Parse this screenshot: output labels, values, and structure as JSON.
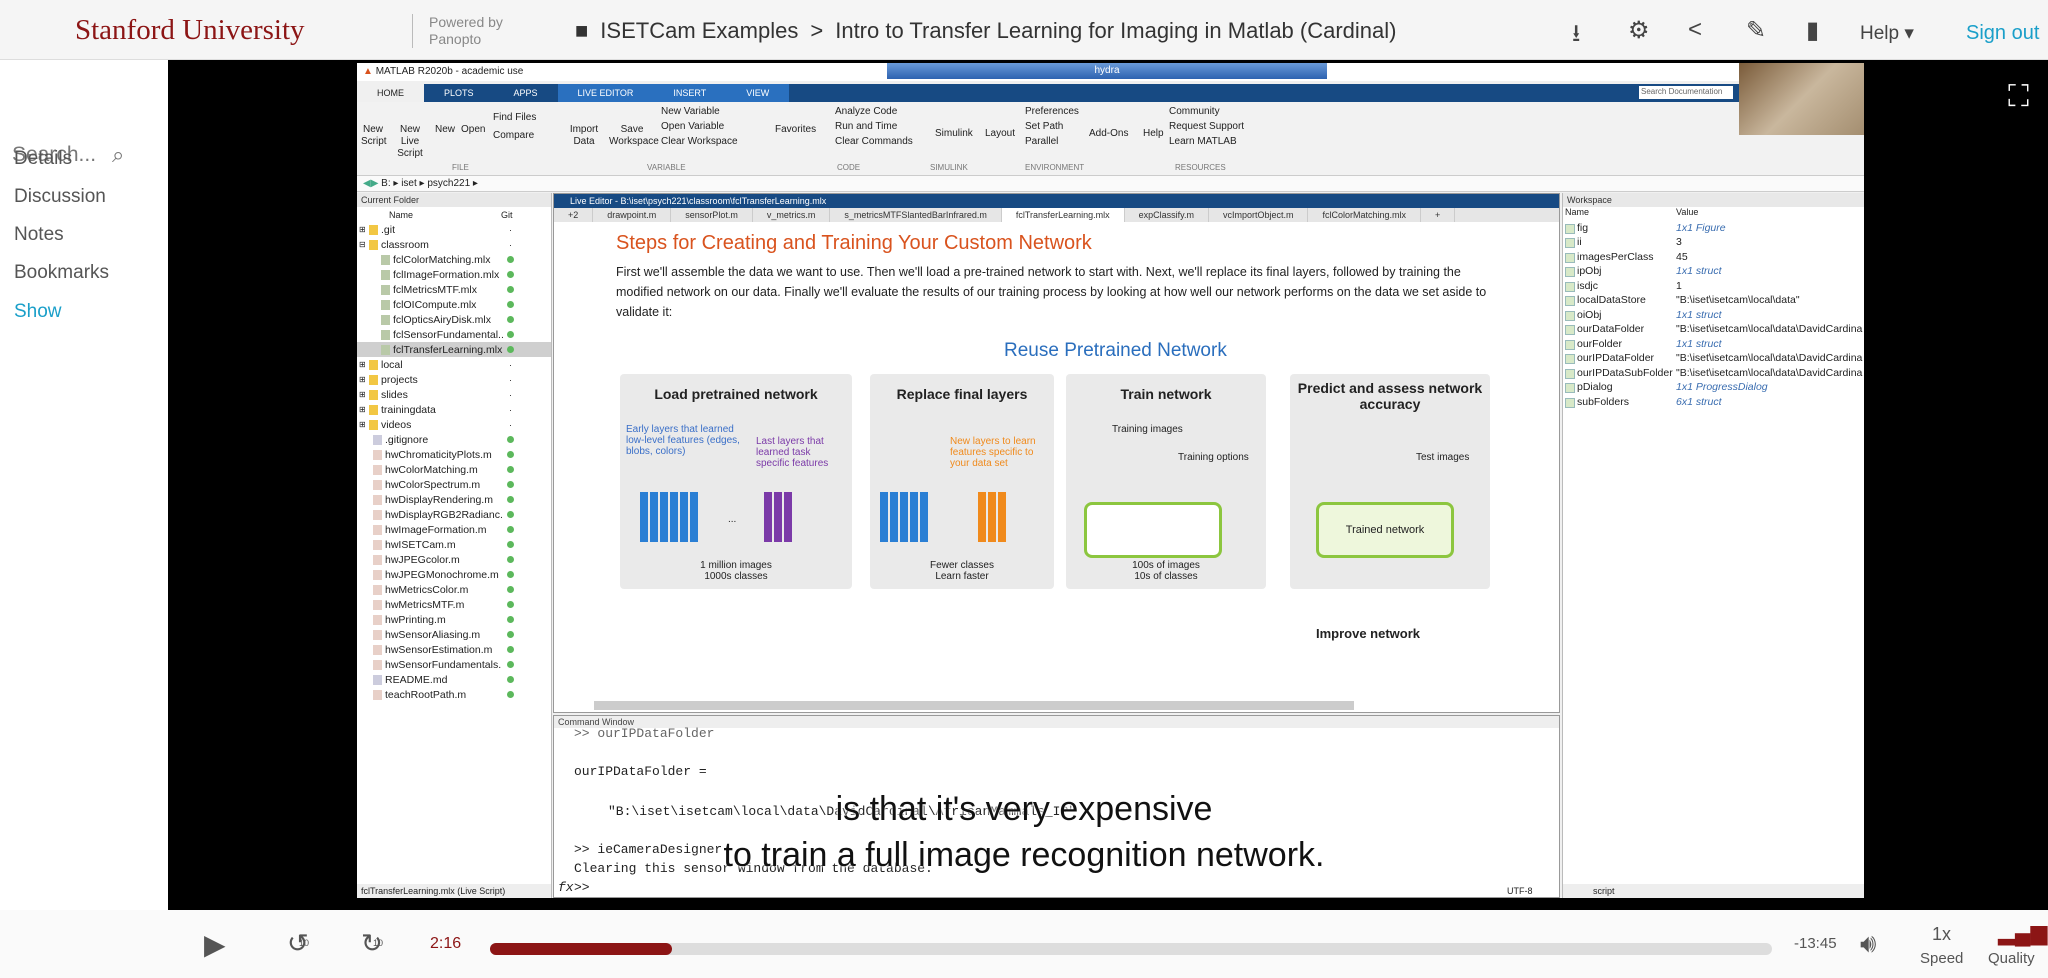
{
  "header": {
    "logo": "Stanford University",
    "powered_by": "Powered by Panopto",
    "folder": "ISETCam Examples",
    "separator": ">",
    "title": "Intro to Transfer Learning for Imaging in Matlab (Cardinal)",
    "help": "Help",
    "sign_out": "Sign out",
    "icons": [
      "download-icon",
      "gear-icon",
      "share-icon",
      "pencil-icon",
      "stats-icon"
    ]
  },
  "sidebar": {
    "search_placeholder": "Search...",
    "items": [
      "Details",
      "Discussion",
      "Notes",
      "Bookmarks",
      "Show"
    ]
  },
  "matlab": {
    "title": "MATLAB R2020b - academic use",
    "remote_title": "hydra",
    "search_doc": "Search Documentation",
    "tabs": [
      "HOME",
      "PLOTS",
      "APPS",
      "LIVE EDITOR",
      "INSERT",
      "VIEW"
    ],
    "ribbon": {
      "new_script": "New Script",
      "new_live_script": "New Live Script",
      "new": "New",
      "open": "Open",
      "find_files": "Find Files",
      "compare": "Compare",
      "import_data": "Import Data",
      "save_workspace": "Save Workspace",
      "new_variable": "New Variable",
      "open_variable": "Open Variable",
      "clear_workspace": "Clear Workspace",
      "favorites": "Favorites",
      "analyze_code": "Analyze Code",
      "run_and_time": "Run and Time",
      "clear_commands": "Clear Commands",
      "simulink": "Simulink",
      "layout": "Layout",
      "preferences": "Preferences",
      "set_path": "Set Path",
      "parallel": "Parallel",
      "add_ons": "Add-Ons",
      "help": "Help",
      "community": "Community",
      "request_support": "Request Support",
      "learn_matlab": "Learn MATLAB",
      "groups": [
        "FILE",
        "VARIABLE",
        "CODE",
        "SIMULINK",
        "ENVIRONMENT",
        "RESOURCES"
      ]
    },
    "address": "B: ▸ iset ▸ psych221 ▸",
    "current_folder": {
      "title": "Current Folder",
      "col_name": "Name",
      "col_git": "Git",
      "items": [
        {
          "name": ".git",
          "type": "folder",
          "git": "dot",
          "indent": 0
        },
        {
          "name": "classroom",
          "type": "folder",
          "git": "dot",
          "indent": 0
        },
        {
          "name": "fclColorMatching.mlx",
          "type": "mlx",
          "git": "ok",
          "indent": 1
        },
        {
          "name": "fclImageFormation.mlx",
          "type": "mlx",
          "git": "ok",
          "indent": 1
        },
        {
          "name": "fclMetricsMTF.mlx",
          "type": "mlx",
          "git": "ok",
          "indent": 1
        },
        {
          "name": "fclOICompute.mlx",
          "type": "mlx",
          "git": "ok",
          "indent": 1
        },
        {
          "name": "fclOpticsAiryDisk.mlx",
          "type": "mlx",
          "git": "ok",
          "indent": 1
        },
        {
          "name": "fclSensorFundamental..",
          "type": "mlx",
          "git": "ok",
          "indent": 1
        },
        {
          "name": "fclTransferLearning.mlx",
          "type": "mlx",
          "git": "ok",
          "indent": 1,
          "selected": true
        },
        {
          "name": "local",
          "type": "folder",
          "git": "dot",
          "indent": 0
        },
        {
          "name": "projects",
          "type": "folder",
          "git": "dot",
          "indent": 0
        },
        {
          "name": "slides",
          "type": "folder",
          "git": "dot",
          "indent": 0
        },
        {
          "name": "trainingdata",
          "type": "folder",
          "git": "dot",
          "indent": 0
        },
        {
          "name": "videos",
          "type": "folder",
          "git": "dot",
          "indent": 0
        },
        {
          "name": ".gitignore",
          "type": "file",
          "git": "ok",
          "indent": 0
        },
        {
          "name": "hwChromaticityPlots.m",
          "type": "m",
          "git": "ok",
          "indent": 0
        },
        {
          "name": "hwColorMatching.m",
          "type": "m",
          "git": "ok",
          "indent": 0
        },
        {
          "name": "hwColorSpectrum.m",
          "type": "m",
          "git": "ok",
          "indent": 0
        },
        {
          "name": "hwDisplayRendering.m",
          "type": "m",
          "git": "ok",
          "indent": 0
        },
        {
          "name": "hwDisplayRGB2Radianc.",
          "type": "m",
          "git": "ok",
          "indent": 0
        },
        {
          "name": "hwImageFormation.m",
          "type": "m",
          "git": "ok",
          "indent": 0
        },
        {
          "name": "hwISETCam.m",
          "type": "m",
          "git": "ok",
          "indent": 0
        },
        {
          "name": "hwJPEGcolor.m",
          "type": "m",
          "git": "ok",
          "indent": 0
        },
        {
          "name": "hwJPEGMonochrome.m",
          "type": "m",
          "git": "ok",
          "indent": 0
        },
        {
          "name": "hwMetricsColor.m",
          "type": "m",
          "git": "ok",
          "indent": 0
        },
        {
          "name": "hwMetricsMTF.m",
          "type": "m",
          "git": "ok",
          "indent": 0
        },
        {
          "name": "hwPrinting.m",
          "type": "m",
          "git": "ok",
          "indent": 0
        },
        {
          "name": "hwSensorAliasing.m",
          "type": "m",
          "git": "ok",
          "indent": 0
        },
        {
          "name": "hwSensorEstimation.m",
          "type": "m",
          "git": "ok",
          "indent": 0
        },
        {
          "name": "hwSensorFundamentals.",
          "type": "m",
          "git": "ok",
          "indent": 0
        },
        {
          "name": "README.md",
          "type": "md",
          "git": "ok",
          "indent": 0
        },
        {
          "name": "teachRootPath.m",
          "type": "m",
          "git": "ok",
          "indent": 0
        }
      ],
      "status": "fclTransferLearning.mlx (Live Script)"
    },
    "editor": {
      "title": "Live Editor - B:\\iset\\psych221\\classroom\\fclTransferLearning.mlx",
      "tabs": [
        "+2",
        "drawpoint.m",
        "sensorPlot.m",
        "v_metrics.m",
        "s_metricsMTFSlantedBarInfrared.m",
        "fclTransferLearning.mlx",
        "expClassify.m",
        "vcImportObject.m",
        "fclColorMatching.mlx",
        "+"
      ],
      "heading": "Steps for Creating and Training Your Custom Network",
      "paragraph": "First we'll assemble the data we want to use. Then we'll load a pre-trained network to start with. Next, we'll replace its final layers, followed by training the modified network on our data. Finally we'll evaluate the results of our training process by looking at how well our network performs on the data we set aside to validate it:",
      "figure": {
        "title": "Reuse Pretrained Network",
        "steps": [
          {
            "title": "Load pretrained network",
            "note1": "Early layers that learned low-level features (edges, blobs, colors)",
            "note2": "Last layers that learned task specific features",
            "caption": "1 million images\n1000s classes"
          },
          {
            "title": "Replace final layers",
            "note1": "New layers to learn features specific to your data set",
            "caption": "Fewer classes\nLearn faster"
          },
          {
            "title": "Train network",
            "note1": "Training images",
            "note2": "Training options",
            "caption": "100s of images\n10s of classes"
          },
          {
            "title": "Predict and assess network accuracy",
            "note1": "Test images",
            "box": "Trained network"
          }
        ],
        "improve": "Improve network",
        "ellipsis": "..."
      }
    },
    "command_window": {
      "title": "Command Window",
      "lines": [
        ">> ourIPDataFolder",
        "ourIPDataFolder =",
        "\"B:\\iset\\isetcam\\local\\data\\DavidCardinal\\AfricanMammals_IP\"",
        ">> ieCameraDesigner",
        "Clearing this sensor window from the database."
      ],
      "prompt": ">>",
      "fx": "fx"
    },
    "workspace": {
      "title": "Workspace",
      "col_name": "Name",
      "col_value": "Value",
      "vars": [
        {
          "name": "fig",
          "value": "1x1 Figure",
          "italic": true
        },
        {
          "name": "ii",
          "value": "3",
          "italic": false
        },
        {
          "name": "imagesPerClass",
          "value": "45",
          "italic": false
        },
        {
          "name": "ipObj",
          "value": "1x1 struct",
          "italic": true
        },
        {
          "name": "isdjc",
          "value": "1",
          "italic": false
        },
        {
          "name": "localDataStore",
          "value": "\"B:\\iset\\isetcam\\local\\data\"",
          "italic": false
        },
        {
          "name": "oiObj",
          "value": "1x1 struct",
          "italic": true
        },
        {
          "name": "ourDataFolder",
          "value": "\"B:\\iset\\isetcam\\local\\data\\DavidCardina",
          "italic": false
        },
        {
          "name": "ourFolder",
          "value": "1x1 struct",
          "italic": true
        },
        {
          "name": "ourIPDataFolder",
          "value": "\"B:\\iset\\isetcam\\local\\data\\DavidCardina",
          "italic": false
        },
        {
          "name": "ourIPDataSubFolder",
          "value": "\"B:\\iset\\isetcam\\local\\data\\DavidCardina",
          "italic": false
        },
        {
          "name": "pDialog",
          "value": "1x1 ProgressDialog",
          "italic": true
        },
        {
          "name": "subFolders",
          "value": "6x1 struct",
          "italic": true
        }
      ]
    },
    "statusbar": {
      "encoding": "UTF-8",
      "type": "script"
    }
  },
  "captions": [
    "is that it's very expensive",
    "to train a full image recognition network."
  ],
  "player": {
    "current_time": "2:16",
    "remaining": "-13:45",
    "progress_fraction": 0.142,
    "speed": "1x",
    "speed_label": "Speed",
    "quality_label": "Quality",
    "rewind": "10",
    "forward": "10",
    "accent": "#8c1515"
  }
}
